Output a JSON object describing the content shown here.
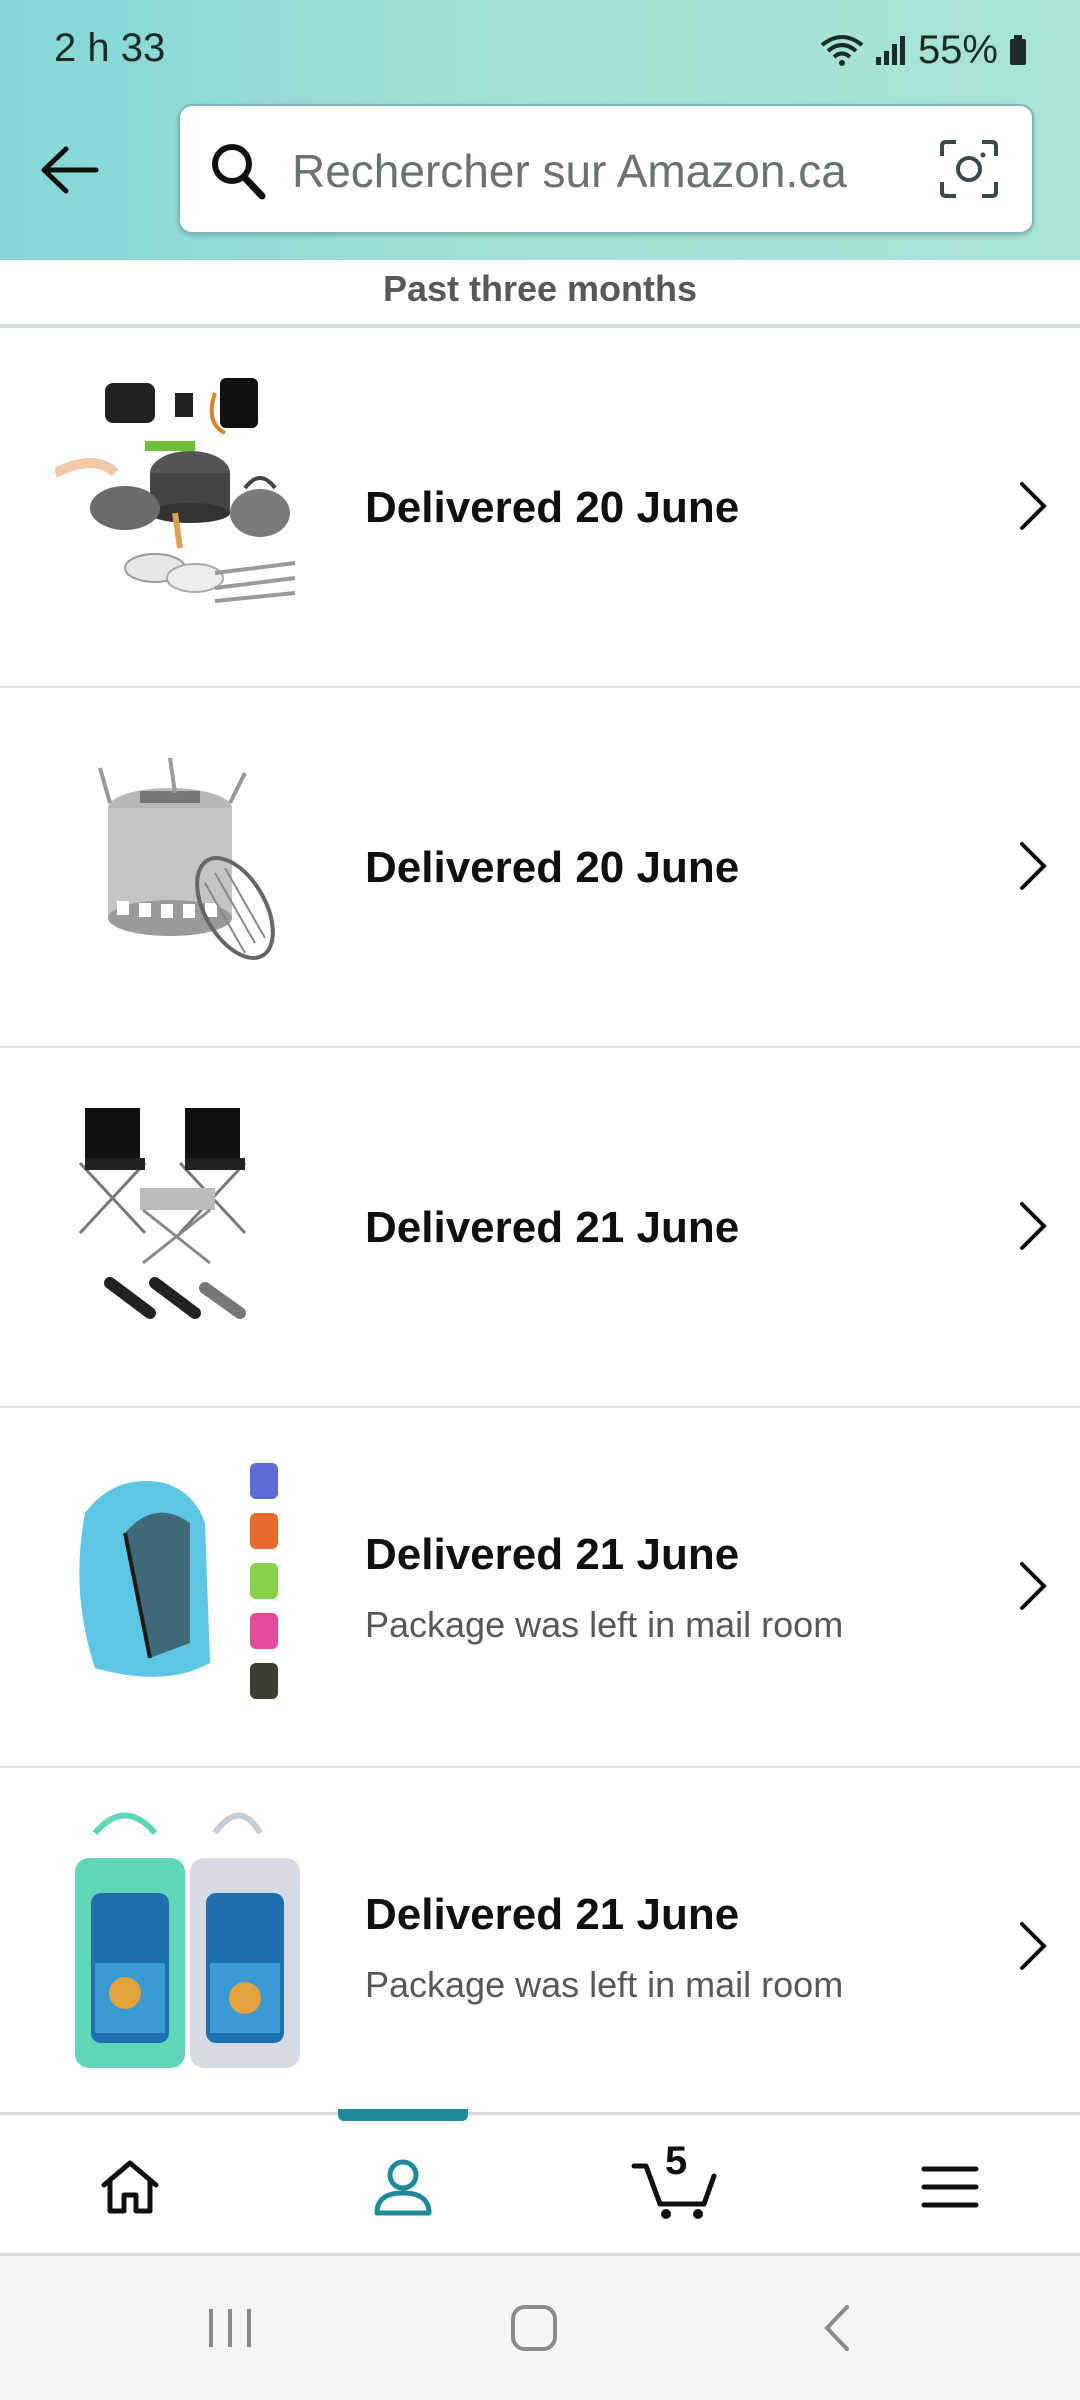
{
  "status_bar": {
    "time": "2 h 33",
    "battery": "55%"
  },
  "search": {
    "placeholder": "Rechercher sur Amazon.ca"
  },
  "section": {
    "title": "Past three months"
  },
  "orders": [
    {
      "status": "Delivered 20 June",
      "note": "",
      "product_icon": "camping-cookware-set-image"
    },
    {
      "status": "Delivered 20 June",
      "note": "",
      "product_icon": "camping-stove-image"
    },
    {
      "status": "Delivered 21 June",
      "note": "",
      "product_icon": "folding-chairs-table-image"
    },
    {
      "status": "Delivered 21 June",
      "note": "Package was left in mail room",
      "product_icon": "snorkel-vest-image"
    },
    {
      "status": "Delivered 21 June",
      "note": "Package was left in mail room",
      "product_icon": "waterproof-phone-pouch-image"
    }
  ],
  "bottom_nav": {
    "cart_count": "5",
    "active": "account"
  },
  "colors": {
    "header_gradient_start": "#84d7d6",
    "header_gradient_end": "#a9e4d6",
    "active_tab": "#1f8a98"
  }
}
